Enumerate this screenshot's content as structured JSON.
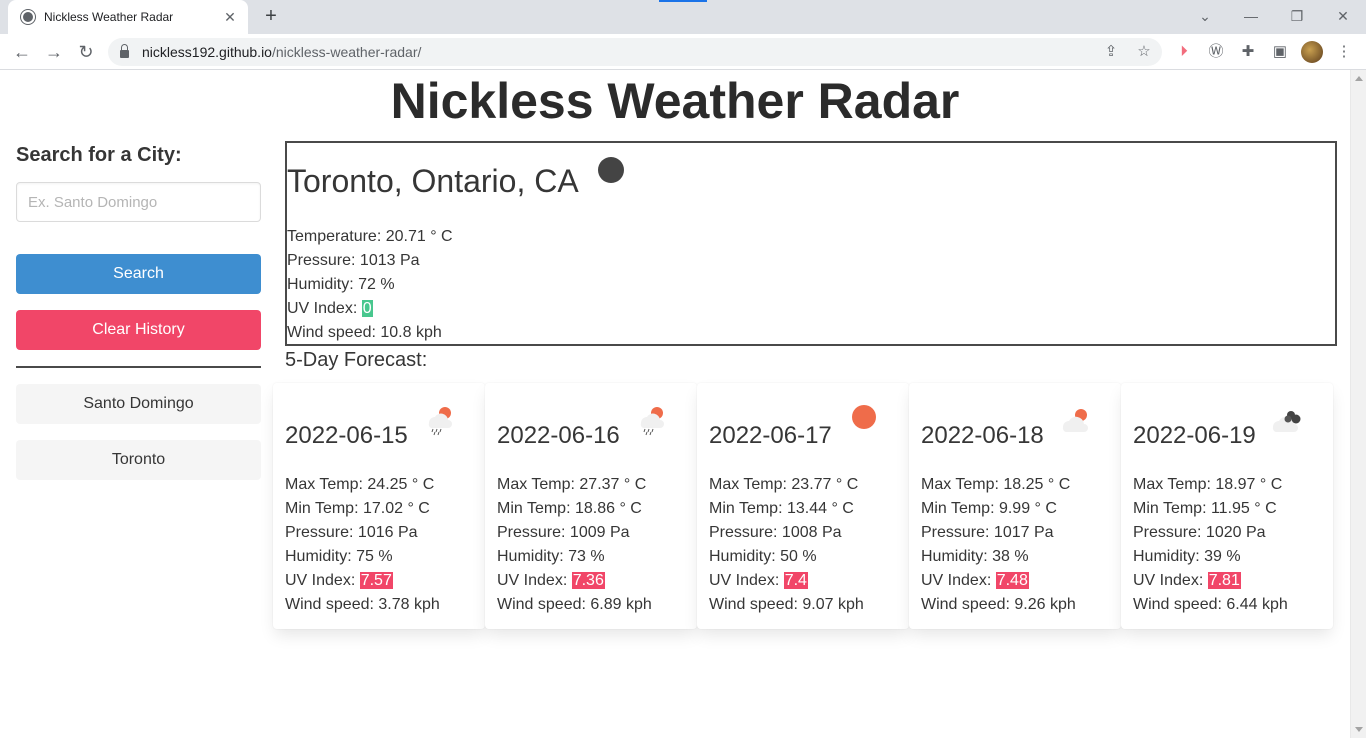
{
  "browser": {
    "tab_title": "Nickless Weather Radar",
    "url_host": "nickless192.github.io",
    "url_path": "/nickless-weather-radar/"
  },
  "page": {
    "title": "Nickless Weather Radar"
  },
  "sidebar": {
    "search_label": "Search for a City:",
    "search_placeholder": "Ex. Santo Domingo",
    "search_button": "Search",
    "clear_button": "Clear History",
    "history": [
      {
        "label": "Santo Domingo"
      },
      {
        "label": "Toronto"
      }
    ]
  },
  "current": {
    "city": "Toronto, Ontario, CA",
    "icon": "night-clear-icon",
    "temperature": "Temperature: 20.71 ° C",
    "pressure": "Pressure: 1013 Pa",
    "humidity": "Humidity: 72 %",
    "uv_label": "UV Index: ",
    "uv_value": "0",
    "wind": "Wind speed: 10.8 kph"
  },
  "forecast": {
    "title": "5-Day Forecast:",
    "days": [
      {
        "date": "2022-06-15",
        "icon": "rain-sun-icon",
        "max": "Max Temp: 24.25 ° C",
        "min": "Min Temp: 17.02 ° C",
        "pressure": "Pressure: 1016 Pa",
        "humidity": "Humidity: 75 %",
        "uv_label": "UV Index: ",
        "uv_value": "7.57",
        "wind": "Wind speed: 3.78 kph"
      },
      {
        "date": "2022-06-16",
        "icon": "rain-sun-icon",
        "max": "Max Temp: 27.37 ° C",
        "min": "Min Temp: 18.86 ° C",
        "pressure": "Pressure: 1009 Pa",
        "humidity": "Humidity: 73 %",
        "uv_label": "UV Index: ",
        "uv_value": "7.36",
        "wind": "Wind speed: 6.89 kph"
      },
      {
        "date": "2022-06-17",
        "icon": "sun-icon",
        "max": "Max Temp: 23.77 ° C",
        "min": "Min Temp: 13.44 ° C",
        "pressure": "Pressure: 1008 Pa",
        "humidity": "Humidity: 50 %",
        "uv_label": "UV Index: ",
        "uv_value": "7.4",
        "wind": "Wind speed: 9.07 kph"
      },
      {
        "date": "2022-06-18",
        "icon": "partly-cloudy-icon",
        "max": "Max Temp: 18.25 ° C",
        "min": "Min Temp: 9.99 ° C",
        "pressure": "Pressure: 1017 Pa",
        "humidity": "Humidity: 38 %",
        "uv_label": "UV Index: ",
        "uv_value": "7.48",
        "wind": "Wind speed: 9.26 kph"
      },
      {
        "date": "2022-06-19",
        "icon": "cloudy-icon",
        "max": "Max Temp: 18.97 ° C",
        "min": "Min Temp: 11.95 ° C",
        "pressure": "Pressure: 1020 Pa",
        "humidity": "Humidity: 39 %",
        "uv_label": "UV Index: ",
        "uv_value": "7.81",
        "wind": "Wind speed: 6.44 kph"
      }
    ]
  },
  "colors": {
    "search_button": "#3e8ed0",
    "clear_button": "#f14668",
    "uv_low": "#48c78e",
    "uv_high": "#f14668",
    "sun": "#ef6c4a"
  }
}
